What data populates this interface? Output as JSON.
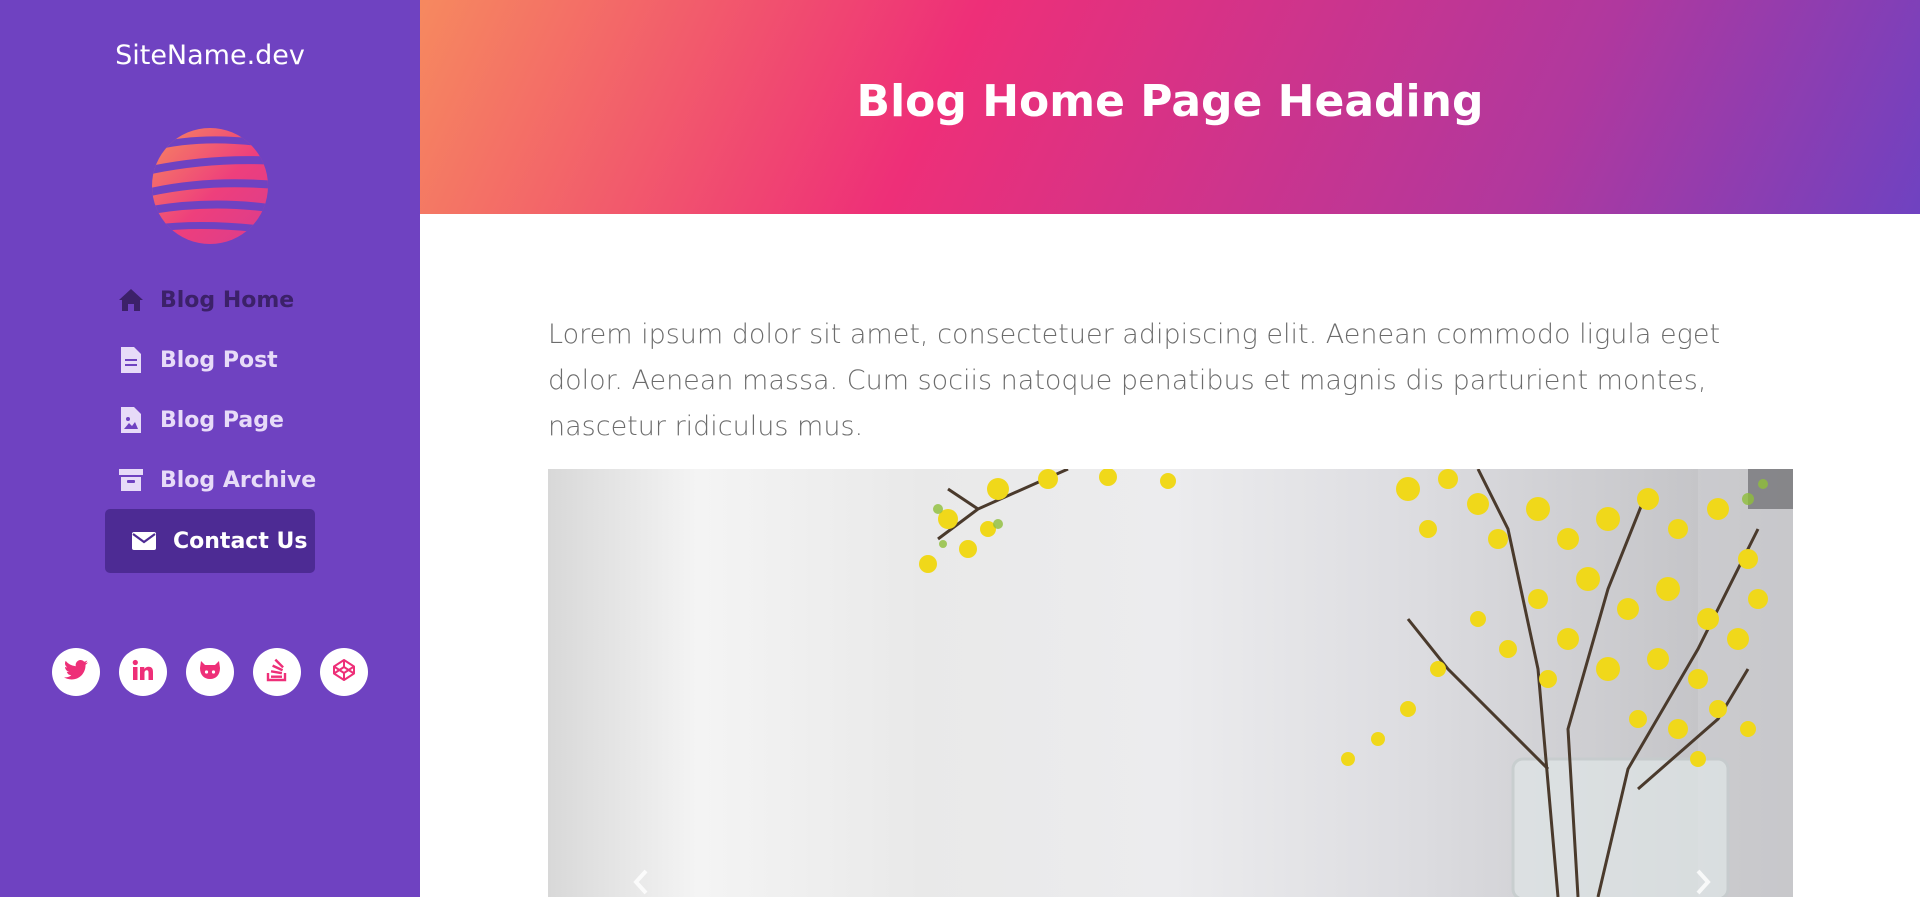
{
  "sidebar": {
    "site_name": "SiteName.dev",
    "logo_icon": "globe-logo-icon",
    "nav": [
      {
        "label": "Blog Home",
        "icon": "home-icon",
        "active": false
      },
      {
        "label": "Blog Post",
        "icon": "file-icon",
        "active": false
      },
      {
        "label": "Blog Page",
        "icon": "file-image-icon",
        "active": false
      },
      {
        "label": "Blog Archive",
        "icon": "archive-icon",
        "active": false
      },
      {
        "label": "Contact Us",
        "icon": "envelope-icon",
        "active": true
      }
    ],
    "socials": [
      "twitter-icon",
      "linkedin-icon",
      "github-icon",
      "stack-overflow-icon",
      "codepen-icon"
    ]
  },
  "header": {
    "title": "Blog Home Page Heading"
  },
  "main": {
    "intro": "Lorem ipsum dolor sit amet, consectetuer adipiscing elit. Aenean commodo ligula eget dolor. Aenean massa. Cum sociis natoque penatibus et magnis dis parturient montes, nascetur ridiculus mus.",
    "carousel": {
      "prev_icon": "chevron-left-icon",
      "next_icon": "chevron-right-icon"
    }
  },
  "colors": {
    "sidebar": "#6f42c1",
    "accent": "#ee2f78",
    "active_nav": "#4d2b94"
  }
}
